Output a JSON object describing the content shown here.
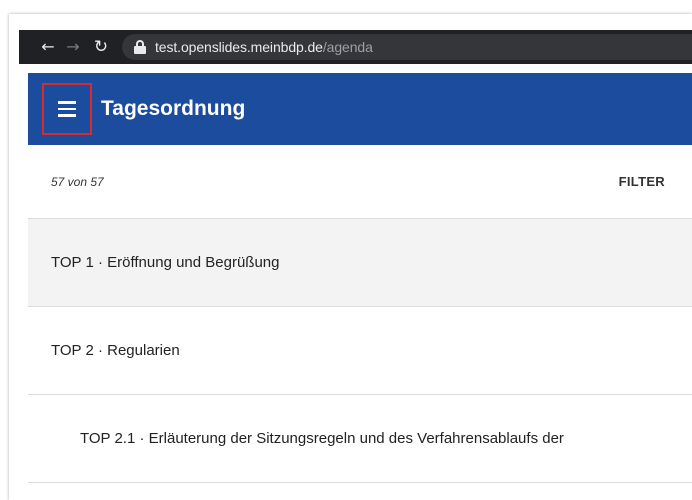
{
  "browser": {
    "url_host": "test.openslides.meinbdp.de",
    "url_path": "/agenda"
  },
  "app": {
    "title": "Tagesordnung"
  },
  "list": {
    "count": "57 von 57",
    "filter_label": "FILTER",
    "items": [
      {
        "label": "TOP 1 · Eröffnung und Begrüßung"
      },
      {
        "label": "TOP 2 · Regularien"
      },
      {
        "label": "TOP 2.1 · Erläuterung der Sitzungsregeln und des Verfahrensablaufs der"
      }
    ]
  },
  "colors": {
    "toolbar": "#1c4c9e",
    "browser_bar": "#202124",
    "highlight": "#d92b2b"
  },
  "icons": {
    "back": "arrow-left-icon",
    "forward": "arrow-right-icon",
    "reload": "reload-icon",
    "lock": "lock-icon",
    "menu": "hamburger-menu-icon"
  }
}
